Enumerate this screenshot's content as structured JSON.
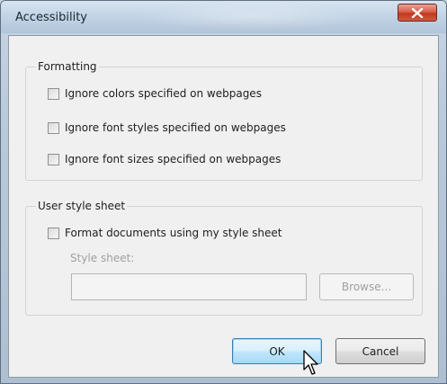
{
  "dialog": {
    "title": "Accessibility",
    "close_icon": "close-x-icon"
  },
  "formatting": {
    "label": "Formatting",
    "options": [
      {
        "label": "Ignore colors specified on webpages",
        "checked": false
      },
      {
        "label": "Ignore font styles specified on webpages",
        "checked": false
      },
      {
        "label": "Ignore font sizes specified on webpages",
        "checked": false
      }
    ]
  },
  "user_style_sheet": {
    "label": "User style sheet",
    "option": {
      "label": "Format documents using my style sheet",
      "checked": false
    },
    "field_label": "Style sheet:",
    "field_value": "",
    "browse_label": "Browse..."
  },
  "buttons": {
    "ok_label": "OK",
    "cancel_label": "Cancel"
  },
  "colors": {
    "close_button": "#c94a32",
    "ok_button_accent": "#3c7fb1"
  }
}
